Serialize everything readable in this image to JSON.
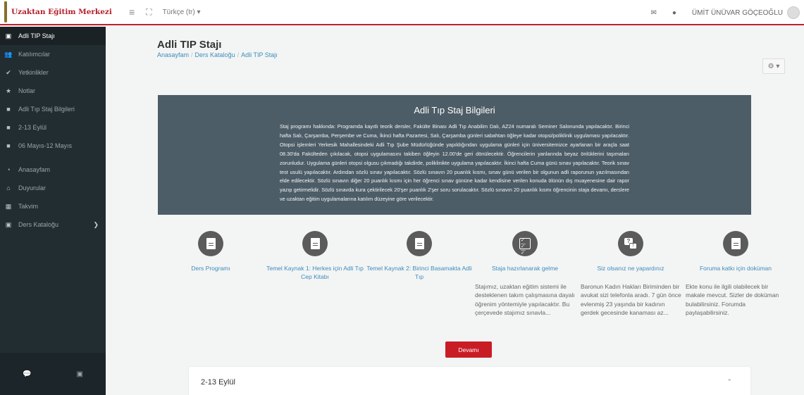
{
  "brand": {
    "name": "Uzaktan Eğitim Merkezi",
    "logo_icon": "university-seal-icon"
  },
  "topbar": {
    "language": "Türkçe (tr) ▾",
    "username": "ÜMİT ÜNÜVAR GÖÇEOĞLU",
    "message_icon": "envelope-icon",
    "notification_icon": "bell-icon"
  },
  "sidebar": {
    "items": [
      {
        "label": "Adli TIP Stajı",
        "icon": "graduation-cap-icon",
        "active": true
      },
      {
        "label": "Katılımcılar",
        "icon": "users-icon"
      },
      {
        "label": "Yetkinlikler",
        "icon": "check-circle-icon"
      },
      {
        "label": "Notlar",
        "icon": "star-icon"
      },
      {
        "label": "Adli Tıp Staj Bilgileri",
        "icon": "folder-icon"
      },
      {
        "label": "2-13 Eylül",
        "icon": "folder-icon"
      },
      {
        "label": "06 Mayıs-12 Mayıs",
        "icon": "folder-icon"
      }
    ],
    "items2": [
      {
        "label": "Anasayfam",
        "icon": "tachometer-icon"
      },
      {
        "label": "Duyurular",
        "icon": "home-icon"
      },
      {
        "label": "Takvim",
        "icon": "calendar-icon"
      },
      {
        "label": "Ders Kataloğu",
        "icon": "graduation-cap-icon"
      }
    ],
    "footer": {
      "left_icon": "comments-icon",
      "right_icon": "graduation-cap-icon"
    }
  },
  "main": {
    "title": "Adli TIP Stajı",
    "breadcrumb": [
      "Anasayfam",
      "Ders Kataloğu",
      "Adli TIP Stajı"
    ],
    "info": {
      "title": "Adli Tıp Staj Bilgileri",
      "text": "Staj programı hakkında: Programda kayıtlı teorik dersler, Fakülte Binası Adli Tıp Anabilim Dalı, AZ24 numaralı Seminer Salonunda yapılacaktır. Birinci hafta Salı, Çarşamba, Perşembe ve Cuma, İkinci hafta Pazartesi, Salı, Çarşamba günleri sabahtan öğleye kadar otopsi/poliklinik uygulaması yapılacaktır. Otopsi işlemleri Yerkesik Mahallesindeki Adli Tıp Şube Müdürlüğünde yapıldığından uygulama günleri için üniversitemizce ayarlanan bir araçla saat 08.30'da Fakülteden çıkılacak, otopsi uygulamasını takiben öğleyin 12.00'de geri dönülecektir. Öğrencilerin yanlarında beyaz önlüklerini taşımaları zorunludur. Uygulama günleri otopsi olgusu çıkmadığı takdirde, poliklinikte uygulama yapılacaktır. İkinci hafta Cuma günü sınav yapılacaktır. Teorik sınav test usulü yapılacaktır. Ardından sözlü sınav yapılacaktır. Sözlü sınavın 20 puanlık kısmı, sınav  günü verilen bir olgunun adli raporunun yazılmasından elde edilecektir. Sözlü sınavın diğer 20 puanlık kısmı için her öğrenci sınav gününe kadar kendisine verilen konuda ölünün dış muayenesine dair rapor yazıp getirmelidir. Sözlü sınavda kura çektirilecek 20'şer puanlık 2'şer soru sorulacaktır. Sözlü sınavın 20 puanlık kısmı öğrencinin staja devamı, derslere ve uzaktan eğitim uygulamalarına katılım düzeyine göre verilecektir."
    },
    "cards": [
      {
        "title": "Ders Programı",
        "icon": "document-icon",
        "desc": ""
      },
      {
        "title": "Temel Kaynak 1: Herkes için Adli Tıp Cep Kitabı",
        "icon": "document-icon",
        "desc": ""
      },
      {
        "title": "Temel Kaynak 2: Birinci Basamakta Adli Tıp",
        "icon": "document-icon",
        "desc": ""
      },
      {
        "title": "Staja hazırlanarak gelme",
        "icon": "checklist-icon",
        "desc": "Stajımız, uzaktan eğitim sistemi ile desteklenen takım çalışmasına dayalı öğrenim yöntemiyle yapılacaktır. Bu çerçevede stajımız sınavla..."
      },
      {
        "title": "Siz olsanız ne yapardınız",
        "icon": "question-answer-icon",
        "desc": "Baronun Kadın Hakları Biriminden bir avukat sizi telefonla aradı. 7 gün önce evlenmiş 23 yaşında bir kadının gerdek gecesinde kanaması az..."
      },
      {
        "title": "Foruma katkı için doküman",
        "icon": "document-icon",
        "desc": "Ekte konu ile ilgili olabilecek bir makale mevcut. Sizler de doküman bulabilirsiniz. Forumda paylaşabilirsiniz."
      }
    ],
    "devami_label": "Devamı",
    "section": {
      "title": "2-13 Eylül",
      "chevron_icon": "chevron-up-icon"
    },
    "settings_icon": "gear-icon"
  }
}
